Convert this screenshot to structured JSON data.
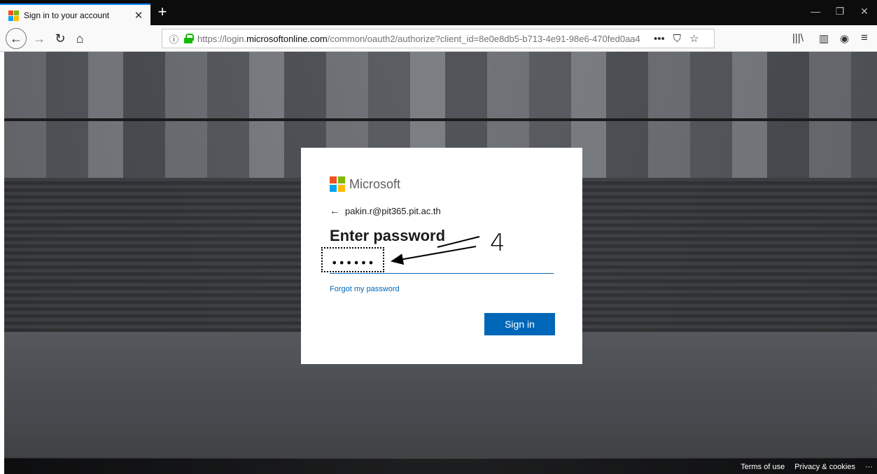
{
  "tab": {
    "title": "Sign in to your account",
    "close": "✕",
    "new_tab": "+"
  },
  "window": {
    "minimize": "—",
    "restore": "❐",
    "close": "✕"
  },
  "navbar": {
    "back": "←",
    "forward": "→",
    "reload": "↻",
    "home": "⌂",
    "url_prefix": "https://login.",
    "url_host": "microsoftonline.com",
    "url_rest": "/common/oauth2/authorize?client_id=8e0e8db5-b713-4e91-98e6-470fed0aa4",
    "page_actions": "•••",
    "pocket": "⛉",
    "bookmark": "☆",
    "library": "|||\\",
    "sidebar": "▥",
    "extension": "◉",
    "menu": "≡",
    "info": "ⓘ"
  },
  "card": {
    "brand": "Microsoft",
    "identity_arrow": "←",
    "identity": "pakin.r@pit365.pit.ac.th",
    "heading": "Enter password",
    "password_value": "••••••",
    "forgot": "Forgot my password",
    "signin": "Sign in"
  },
  "annotation": {
    "number": "4"
  },
  "footer": {
    "terms": "Terms of use",
    "privacy": "Privacy & cookies",
    "more": "···"
  },
  "colors": {
    "ms_red": "#f25022",
    "ms_green": "#7fba00",
    "ms_blue": "#00a4ef",
    "ms_yellow": "#ffb900",
    "accent": "#0067b8"
  }
}
